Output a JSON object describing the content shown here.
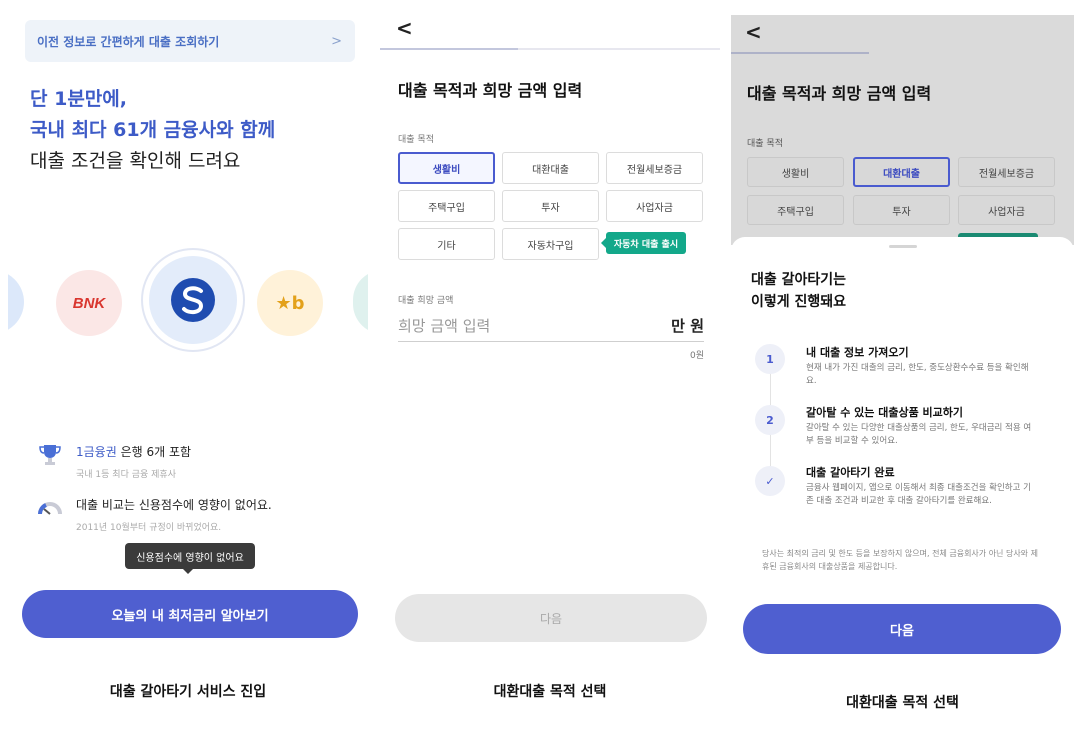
{
  "screen1": {
    "banner_text": "이전 정보로 간편하게 대출 조회하기",
    "banner_chevron": ">",
    "headline_line1": "단 1분만에,",
    "headline_line2": "국내 최다 61개 금융사와 함께",
    "headline_line3": "대출 조건을 확인해 드려요",
    "logos": [
      {
        "name": "bnk",
        "text": "BNK",
        "color": "#d9362f",
        "bg": "#fbe7e6"
      },
      {
        "name": "shinhan",
        "text": "S",
        "color": "#1f4cb0",
        "bg": "#e3ecfa"
      },
      {
        "name": "kb",
        "text": "★b",
        "color": "#e3a11b",
        "bg": "#fff2d9"
      }
    ],
    "feature1_title_blue": "1금융권",
    "feature1_title_rest": " 은행 6개 포함",
    "feature1_sub": "국내 1등 최다 금융 제휴사",
    "feature2_title": "대출 비교는 신용점수에 영향이 없어요.",
    "feature2_sub": "2011년 10월부터 규정이 바뀌었어요.",
    "tooltip": "신용점수에 영향이 없어요",
    "cta": "오늘의 내 최저금리 알아보기",
    "caption": "대출 갈아타기 서비스 진입"
  },
  "screen2": {
    "back": "<",
    "title": "대출 목적과 희망 금액 입력",
    "purpose_label": "대출 목적",
    "purposes": [
      "생활비",
      "대환대출",
      "전월세보증금",
      "주택구입",
      "투자",
      "사업자금",
      "기타",
      "자동차구입"
    ],
    "selected_purpose": "생활비",
    "badge": "자동차 대출 출시",
    "amount_label": "대출 희망 금액",
    "amount_placeholder": "희망 금액 입력",
    "amount_unit": "만 원",
    "amount_value": "0원",
    "next": "다음",
    "caption": "대환대출 목적 선택"
  },
  "screen3": {
    "back": "<",
    "title": "대출 목적과 희망 금액 입력",
    "purpose_label": "대출 목적",
    "purposes": [
      "생활비",
      "대환대출",
      "전월세보증금",
      "주택구입",
      "투자",
      "사업자금"
    ],
    "selected_purpose": "대환대출",
    "sheet_title_line1": "대출 갈아타기는",
    "sheet_title_line2": "이렇게 진행돼요",
    "steps": [
      {
        "marker": "1",
        "title": "내 대출 정보 가져오기",
        "desc": "현재 내가 가진 대출의 금리, 한도, 중도상환수수료 등을 확인해요."
      },
      {
        "marker": "2",
        "title": "갈아탈 수 있는 대출상품 비교하기",
        "desc": "갈아탈 수 있는 다양한 대출상품의 금리, 한도, 우대금리 적용 여부 등을 비교할 수 있어요."
      },
      {
        "marker": "✓",
        "title": "대출 갈아타기 완료",
        "desc": "금융사 웹페이지, 앱으로 이동해서 최종 대출조건을 확인하고 기존 대출 조건과 비교한 후 대출 갈아타기를 완료해요."
      }
    ],
    "note": "당사는 최적의 금리 및 한도 등을 보장하지 않으며, 전체 금융회사가 아닌 당사와 제휴된 금융회사의 대출상품을 제공합니다.",
    "next": "다음",
    "caption": "대환대출 목적 선택"
  }
}
